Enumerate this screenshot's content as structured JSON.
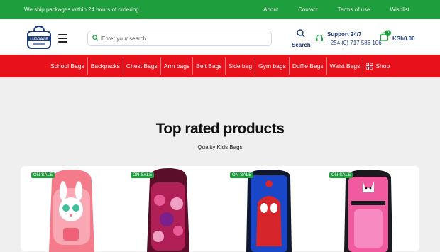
{
  "topbar": {
    "shipping_note": "We ship packages within 24 hours of ordering",
    "links": [
      "About",
      "Contact",
      "Terms of use",
      "Wishlist"
    ]
  },
  "header": {
    "logo_text": "LUGGAGE",
    "search_placeholder": "Enter your search",
    "search_label": "Search",
    "support_title": "Support 24/7",
    "support_phone": "+254 (0) 717 586 106",
    "cart_count": "0",
    "cart_total": "KSh0.00"
  },
  "nav": {
    "items": [
      "School Bags",
      "Backpacks",
      "Chest Bags",
      "Arm bags",
      "Belt Bags",
      "Side bag",
      "Gym bags",
      "Duffle Bags",
      "Waist Bags"
    ],
    "shop_label": "Shop"
  },
  "section": {
    "title": "Top rated products",
    "subtitle": "Quality Kids Bags"
  },
  "products": [
    {
      "badge": "ON SALE",
      "image": "pink-bunny-backpack"
    },
    {
      "badge": "ON SALE",
      "image": "barbie-backpack"
    },
    {
      "badge": "ON SALE",
      "image": "spiderman-backpack"
    },
    {
      "badge": "ON SALE",
      "image": "pink-cat-backpack"
    }
  ],
  "colors": {
    "topbar_green": "#1e9e3c",
    "nav_red": "#e8101a",
    "brand_navy": "#1d3a7a"
  }
}
